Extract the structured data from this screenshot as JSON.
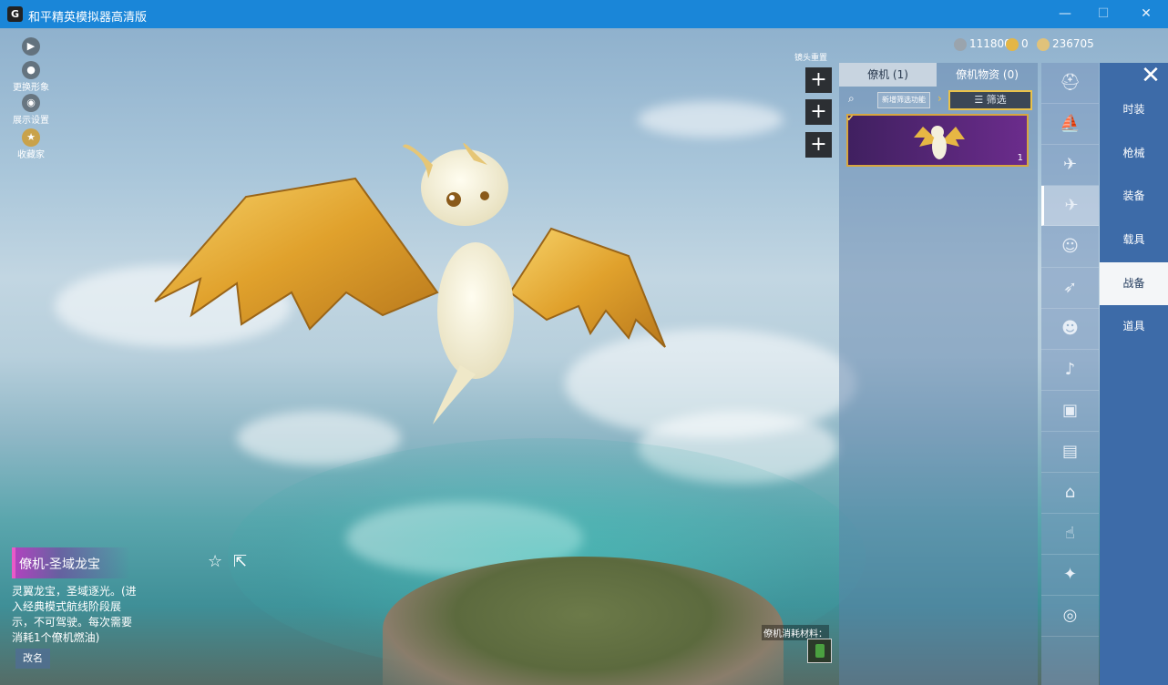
{
  "window": {
    "title": "和平精英模拟器高清版",
    "app_icon_letter": "G",
    "minimize_glyph": "—",
    "maximize_glyph": "☐",
    "close_glyph": "✕"
  },
  "left_tools": [
    {
      "label": "",
      "icon": "play-icon",
      "glyph": "▶"
    },
    {
      "label": "更换形象",
      "icon": "avatar-icon",
      "glyph": "●"
    },
    {
      "label": "展示设置",
      "icon": "eye-icon",
      "glyph": "◉"
    },
    {
      "label": "收藏家",
      "icon": "collector-badge-icon",
      "glyph": "★"
    }
  ],
  "view_hint": "镜头重置",
  "add_buttons": [
    "+",
    "+",
    "+"
  ],
  "currencies": [
    {
      "icon": "silver-coin-icon",
      "value": "111800",
      "color": "#9aa4ad"
    },
    {
      "icon": "gold-token-icon",
      "value": "0",
      "color": "#e3b647"
    },
    {
      "icon": "coupon-icon",
      "value": "236705",
      "color": "#e0c27a"
    }
  ],
  "inventory": {
    "tabs": [
      {
        "label": "僚机 (1)",
        "active": true
      },
      {
        "label": "僚机物资 (0)",
        "active": false
      }
    ],
    "search_icon": "search-icon",
    "new_filter_label": "新增筛选功能",
    "filter_label": "筛选",
    "items": [
      {
        "count": "1",
        "rarity_color": "#d7a640"
      }
    ]
  },
  "category_icons": [
    "helmet-icon",
    "ship-icon",
    "drone-icon",
    "plane-icon",
    "smile-icon",
    "glider-icon",
    "mask-icon",
    "speaker-icon",
    "chat-icon",
    "photo-icon",
    "extinguisher-icon",
    "gesture-icon",
    "magic-wand-icon",
    "ufo-icon"
  ],
  "categories": [
    {
      "label": "时装",
      "active": false
    },
    {
      "label": "枪械",
      "active": false
    },
    {
      "label": "装备",
      "active": false
    },
    {
      "label": "载具",
      "active": false
    },
    {
      "label": "战备",
      "active": true
    },
    {
      "label": "道具",
      "active": false
    }
  ],
  "close_glyph": "✕",
  "item_detail": {
    "name": "僚机-圣域龙宝",
    "description": "灵翼龙宝，圣域逐光。(进入经典模式航线阶段展示，不可驾驶。每次需要消耗1个僚机燃油)",
    "rename_label": "改名",
    "favorite_icon": "star-icon",
    "share_icon": "share-icon"
  },
  "consume_material_label": "僚机消耗材料："
}
